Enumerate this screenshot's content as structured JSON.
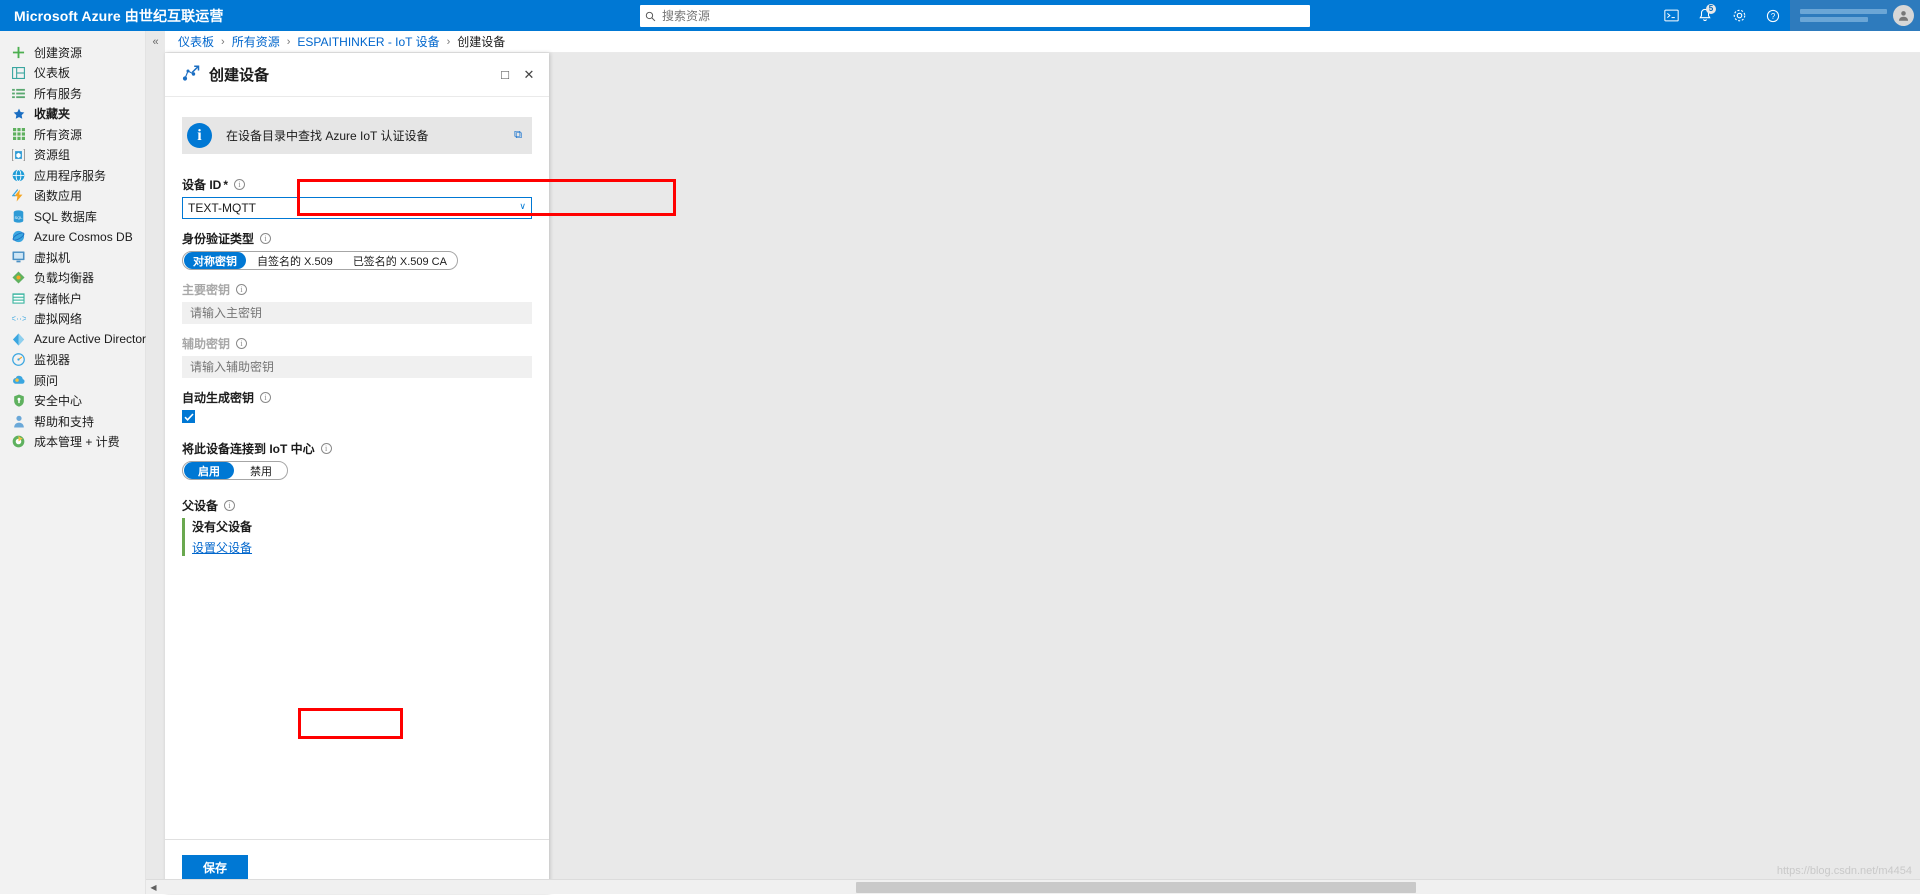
{
  "topbar": {
    "brand": "Microsoft Azure 由世纪互联运营",
    "search_placeholder": "搜索资源",
    "search_value": "",
    "icons": [
      {
        "name": "cloud-shell-icon",
        "glyph": "⌨"
      },
      {
        "name": "notifications-icon",
        "glyph": "⊙",
        "badge": "5"
      },
      {
        "name": "settings-gear-icon",
        "glyph": "⚙"
      },
      {
        "name": "help-icon",
        "glyph": "?"
      }
    ],
    "avatar_glyph": "●"
  },
  "sidebar": {
    "items": [
      {
        "label": "创建资源",
        "icon": "plus-icon"
      },
      {
        "label": "仪表板",
        "icon": "dashboard-icon"
      },
      {
        "label": "所有服务",
        "icon": "all-services-icon"
      },
      {
        "label": "收藏夹",
        "icon": "star-icon",
        "bold": true
      },
      {
        "label": "所有资源",
        "icon": "all-resources-icon"
      },
      {
        "label": "资源组",
        "icon": "resource-group-icon"
      },
      {
        "label": "应用程序服务",
        "icon": "app-service-icon"
      },
      {
        "label": "函数应用",
        "icon": "function-app-icon"
      },
      {
        "label": "SQL 数据库",
        "icon": "sql-database-icon"
      },
      {
        "label": "Azure Cosmos DB",
        "icon": "cosmos-db-icon"
      },
      {
        "label": "虚拟机",
        "icon": "virtual-machine-icon"
      },
      {
        "label": "负载均衡器",
        "icon": "load-balancer-icon"
      },
      {
        "label": "存储帐户",
        "icon": "storage-account-icon"
      },
      {
        "label": "虚拟网络",
        "icon": "virtual-network-icon"
      },
      {
        "label": "Azure Active Directory",
        "icon": "azure-ad-icon"
      },
      {
        "label": "监视器",
        "icon": "monitor-icon"
      },
      {
        "label": "顾问",
        "icon": "advisor-icon"
      },
      {
        "label": "安全中心",
        "icon": "security-center-icon"
      },
      {
        "label": "帮助和支持",
        "icon": "help-support-icon"
      },
      {
        "label": "成本管理 + 计费",
        "icon": "cost-management-icon"
      }
    ]
  },
  "breadcrumb": {
    "items": [
      "仪表板",
      "所有资源",
      "ESPAITHINKER - IoT 设备",
      "创建设备"
    ],
    "separator": "›",
    "collapse_glyph": "«"
  },
  "blade": {
    "title": "创建设备",
    "icon": "iot-device-icon",
    "maximize_glyph": "□",
    "close_glyph": "✕",
    "info_banner": {
      "text": "在设备目录中查找 Azure IoT 认证设备",
      "icon": "info-circle-icon",
      "external_glyph": "⧉"
    },
    "fields": {
      "device_id": {
        "label": "设备 ID",
        "required_mark": "*",
        "value": "TEXT-MQTT",
        "chevron": "∨"
      },
      "auth_type": {
        "label": "身份验证类型",
        "options": [
          "对称密钥",
          "自签名的 X.509",
          "已签名的 X.509 CA"
        ],
        "selected": "对称密钥"
      },
      "primary_key": {
        "label": "主要密钥",
        "placeholder": "请输入主密钥",
        "value": ""
      },
      "secondary_key": {
        "label": "辅助密钥",
        "placeholder": "请输入辅助密钥",
        "value": ""
      },
      "auto_generate_keys": {
        "label": "自动生成密钥",
        "checked": true
      },
      "connect_to_hub": {
        "label": "将此设备连接到 IoT 中心",
        "options": [
          "启用",
          "禁用"
        ],
        "selected": "启用"
      },
      "parent_device": {
        "label": "父设备",
        "status": "没有父设备",
        "link": "设置父设备"
      }
    },
    "footer": {
      "save_label": "保存"
    }
  },
  "scrollbar": {
    "left_arrow": "◀",
    "right_arrow": "▶"
  },
  "watermark": "https://blog.csdn.net/m4454",
  "colors": {
    "azure_blue": "#0078d4",
    "annotation_red": "#ff0000",
    "parent_green": "#6aa84f",
    "link_blue": "#0066cc"
  }
}
